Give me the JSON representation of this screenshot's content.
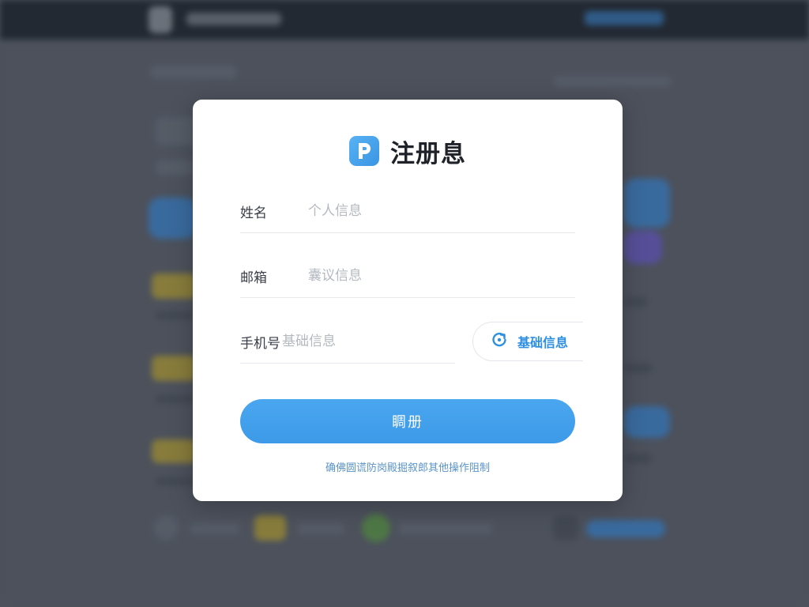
{
  "modal": {
    "title": "注册息",
    "fields": [
      {
        "label": "姓名",
        "placeholder": "个人信息"
      },
      {
        "label": "邮箱",
        "placeholder": "囊议信息"
      },
      {
        "label": "手机号",
        "placeholder": "基础信息"
      }
    ],
    "code_button_label": "基础信息",
    "submit_label": "睭册",
    "footer_note": "确佛圆谎防岗殿掘叙郎其他操作阻制"
  },
  "colors": {
    "accent": "#3c9ae8",
    "app_icon": "#4aa6ef",
    "overlay": "#5a5f6b"
  },
  "icons": {
    "app": "parking-p-icon",
    "code_button": "refresh-icon"
  }
}
